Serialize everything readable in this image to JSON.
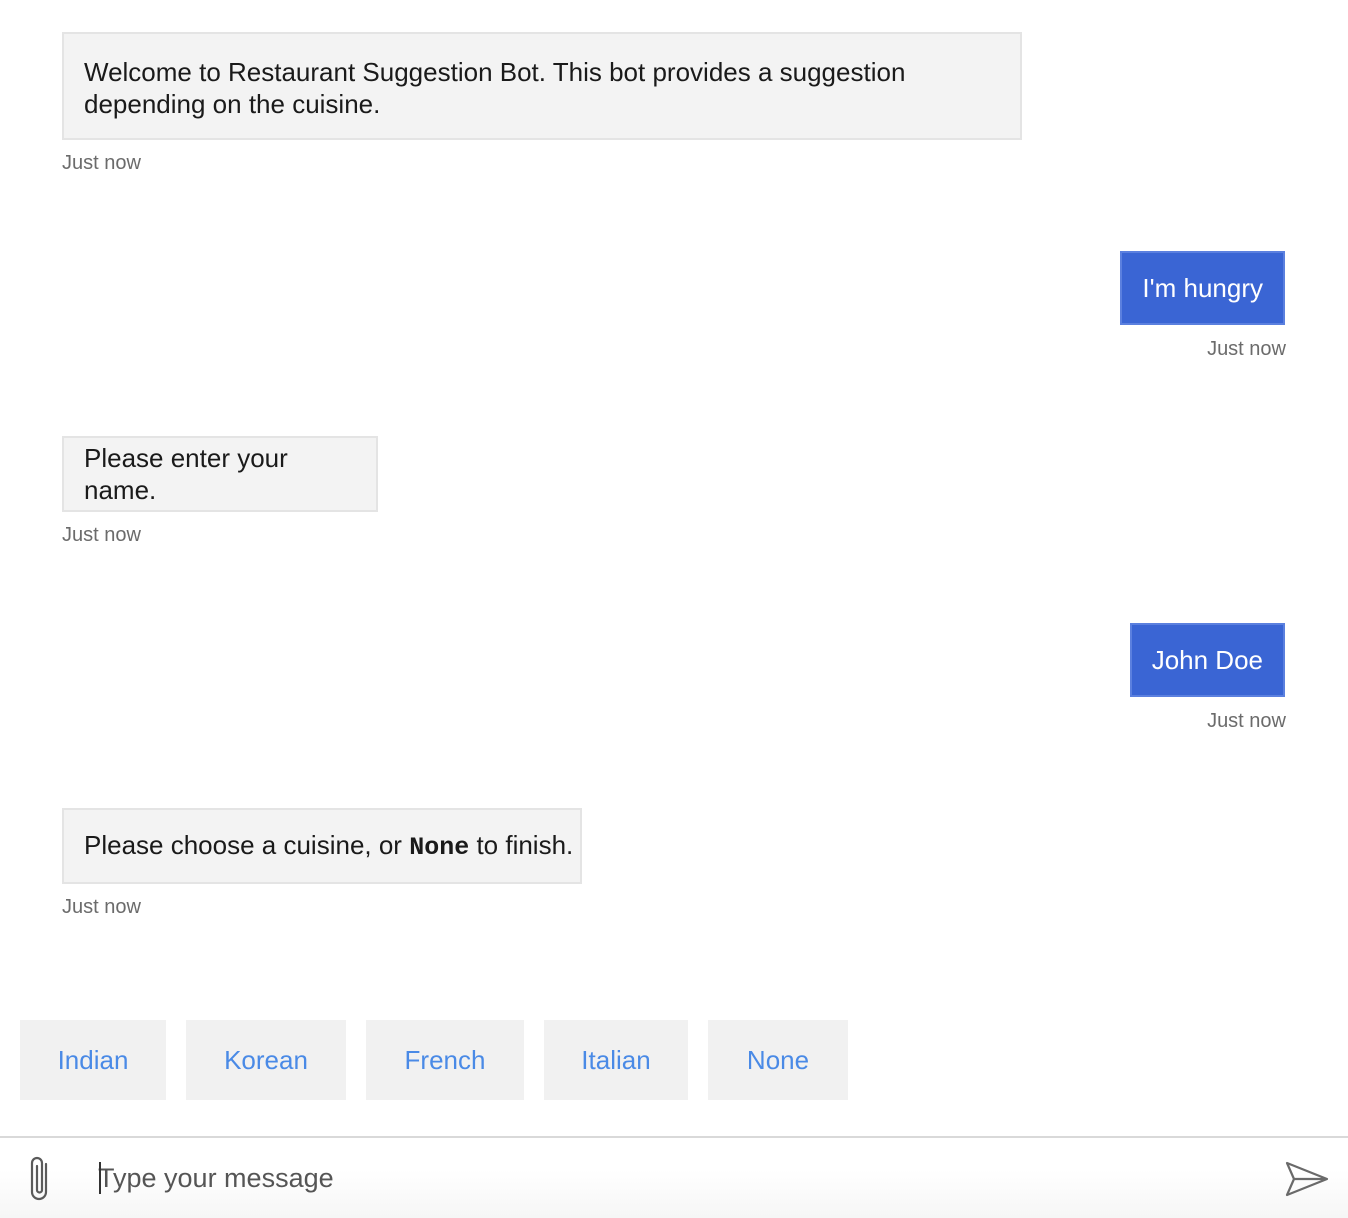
{
  "messages": [
    {
      "from": "bot",
      "text": "Welcome to Restaurant Suggestion Bot. This bot provides a suggestion depending on the cuisine.",
      "time": "Just now"
    },
    {
      "from": "user",
      "text": "I'm hungry",
      "time": "Just now"
    },
    {
      "from": "bot",
      "text": "Please enter your name.",
      "time": "Just now"
    },
    {
      "from": "user",
      "text": "John Doe",
      "time": "Just now"
    },
    {
      "from": "bot",
      "text_before": "Please choose a cuisine, or ",
      "code": "None",
      "text_after": " to finish.",
      "time": "Just now"
    }
  ],
  "suggested_actions": [
    "Indian",
    "Korean",
    "French",
    "Italian",
    "None"
  ],
  "input": {
    "placeholder": "Type your message",
    "value": ""
  },
  "icons": {
    "attach": "paperclip-icon",
    "send": "send-icon"
  },
  "colors": {
    "user_bubble": "#3a65d4",
    "bot_bubble": "#f3f3f3",
    "suggestion_text": "#4a8ae6",
    "timestamp": "#6b6b6b"
  }
}
